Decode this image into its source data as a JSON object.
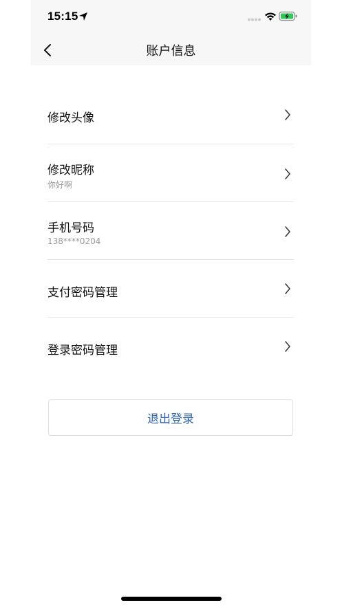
{
  "status_bar": {
    "time": "15:15"
  },
  "header": {
    "title": "账户信息"
  },
  "menu": [
    {
      "label": "修改头像",
      "sub": ""
    },
    {
      "label": "修改昵称",
      "sub": "你好啊"
    },
    {
      "label": "手机号码",
      "sub": "138****0204"
    },
    {
      "label": "支付密码管理",
      "sub": ""
    },
    {
      "label": "登录密码管理",
      "sub": ""
    }
  ],
  "logout": {
    "label": "退出登录"
  },
  "colors": {
    "accent": "#2f66b3",
    "header_bg": "#f7f7f7",
    "divider": "#e6e6e6",
    "battery_green": "#34c759"
  }
}
